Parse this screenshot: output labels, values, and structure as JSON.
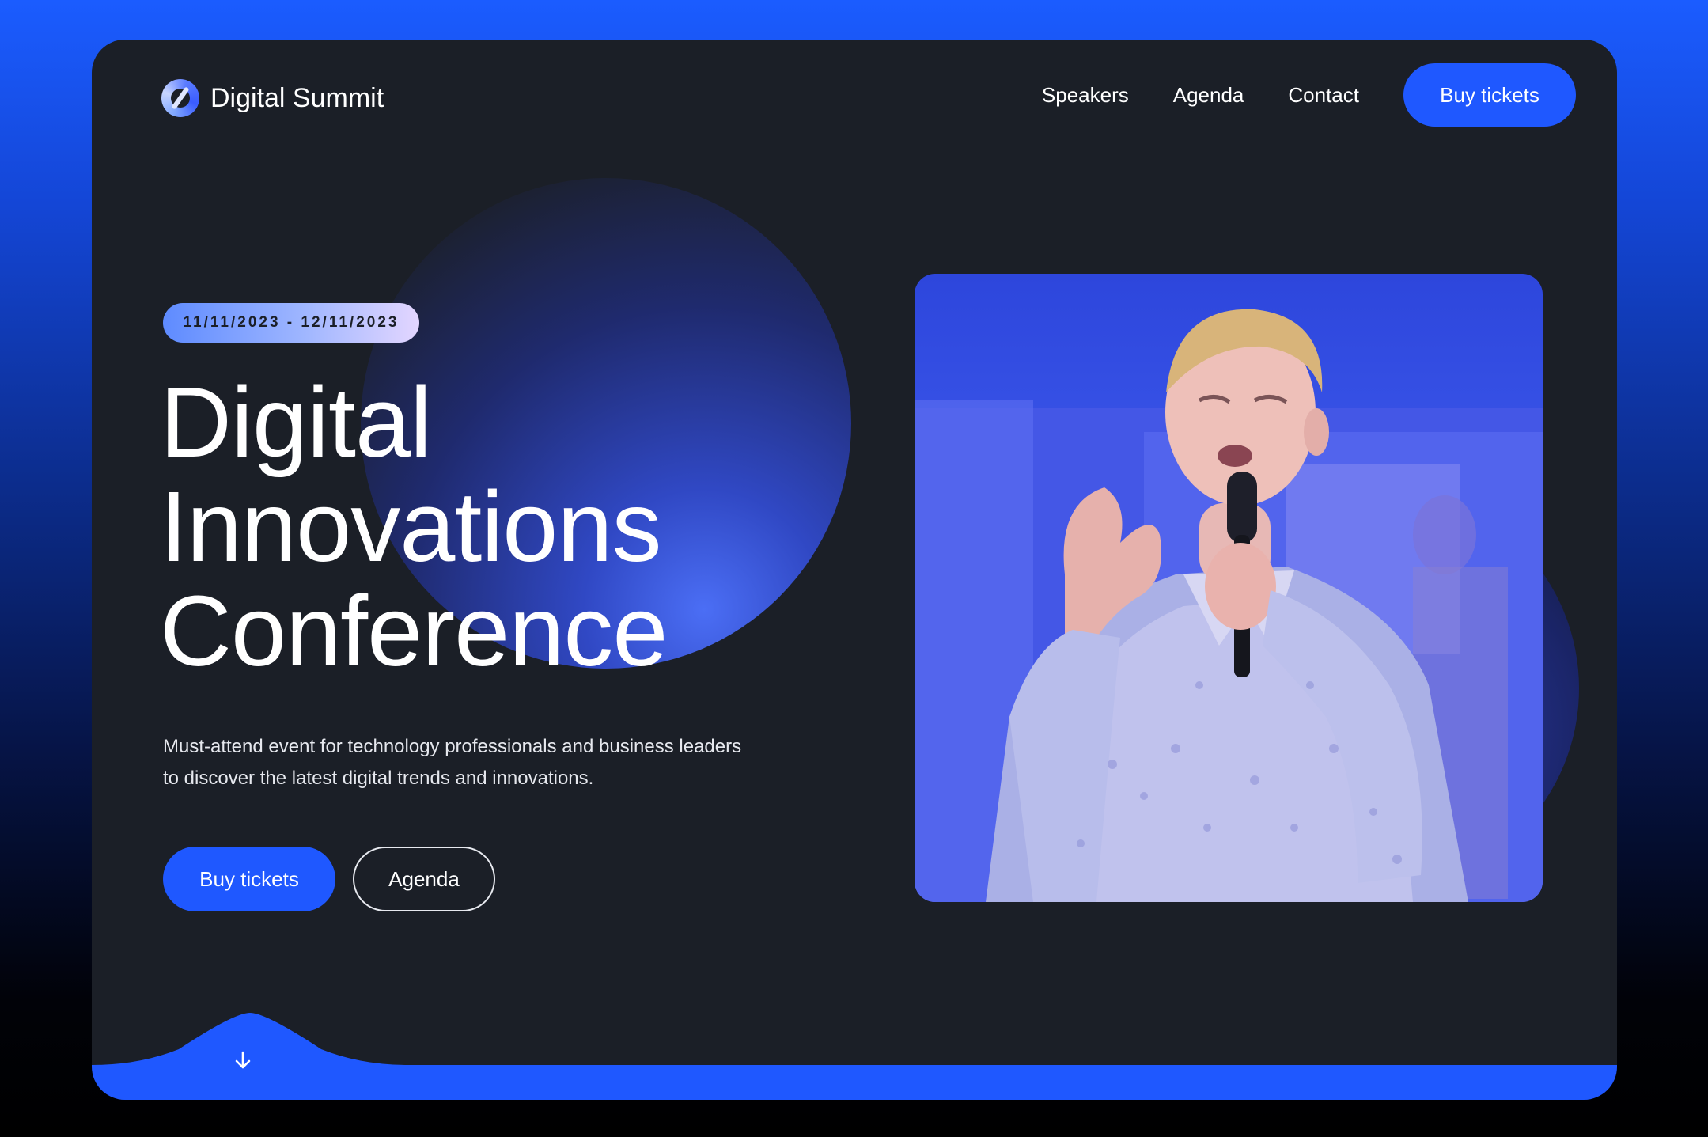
{
  "brand": {
    "name": "Digital Summit",
    "accent": "#1f58ff"
  },
  "nav": {
    "items": [
      {
        "label": "Speakers"
      },
      {
        "label": "Agenda"
      },
      {
        "label": "Contact"
      }
    ],
    "cta_label": "Buy tickets"
  },
  "hero": {
    "date_range": "11/11/2023 - 12/11/2023",
    "title_lines": [
      "Digital",
      "Innovations",
      "Conference"
    ],
    "description": "Must-attend event for technology professionals and business leaders to discover the latest digital trends and innovations.",
    "primary_button": "Buy tickets",
    "secondary_button": "Agenda"
  },
  "icons": {
    "logo": "ring-logo-icon",
    "scroll": "arrow-down-icon"
  }
}
